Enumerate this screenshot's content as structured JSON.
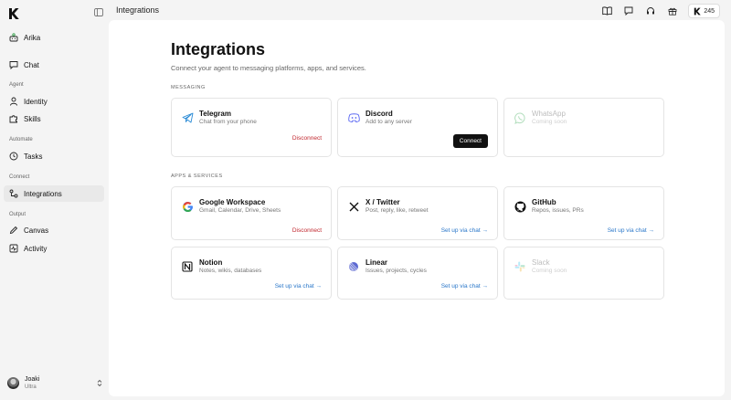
{
  "topbar": {
    "page_title": "Integrations",
    "credits": "245",
    "icons": [
      "book-icon",
      "chat-bubble-icon",
      "headset-icon",
      "gift-icon"
    ]
  },
  "sidebar": {
    "top_items": [
      {
        "label": "Arika",
        "icon": "agent-icon"
      },
      {
        "label": "Chat",
        "icon": "chat-icon"
      }
    ],
    "sections": [
      {
        "label": "Agent",
        "items": [
          {
            "label": "Identity",
            "icon": "person-icon"
          },
          {
            "label": "Skills",
            "icon": "puzzle-icon"
          }
        ]
      },
      {
        "label": "Automate",
        "items": [
          {
            "label": "Tasks",
            "icon": "clock-icon"
          }
        ]
      },
      {
        "label": "Connect",
        "items": [
          {
            "label": "Integrations",
            "icon": "integrations-icon",
            "active": true
          }
        ]
      },
      {
        "label": "Output",
        "items": [
          {
            "label": "Canvas",
            "icon": "pen-icon"
          },
          {
            "label": "Activity",
            "icon": "activity-icon"
          }
        ]
      }
    ],
    "user": {
      "name": "Joaki",
      "plan": "Ultra"
    }
  },
  "main": {
    "title": "Integrations",
    "subtitle": "Connect your agent to messaging platforms, apps, and services.",
    "messaging": {
      "label": "MESSAGING",
      "cards": [
        {
          "name": "Telegram",
          "desc": "Chat from your phone",
          "action": "Disconnect",
          "icon": "telegram-icon"
        },
        {
          "name": "Discord",
          "desc": "Add to any server",
          "action": "Connect",
          "icon": "discord-icon"
        },
        {
          "name": "WhatsApp",
          "desc": "Coming soon",
          "icon": "whatsapp-icon"
        }
      ]
    },
    "apps": {
      "label": "APPS & SERVICES",
      "cards": [
        {
          "name": "Google Workspace",
          "desc": "Gmail, Calendar, Drive, Sheets",
          "action": "Disconnect",
          "icon": "google-icon"
        },
        {
          "name": "X / Twitter",
          "desc": "Post, reply, like, retweet",
          "action": "Set up via chat →",
          "icon": "x-icon"
        },
        {
          "name": "GitHub",
          "desc": "Repos, issues, PRs",
          "action": "Set up via chat →",
          "icon": "github-icon"
        },
        {
          "name": "Notion",
          "desc": "Notes, wikis, databases",
          "action": "Set up via chat →",
          "icon": "notion-icon"
        },
        {
          "name": "Linear",
          "desc": "Issues, projects, cycles",
          "action": "Set up via chat →",
          "icon": "linear-icon"
        },
        {
          "name": "Slack",
          "desc": "Coming soon",
          "icon": "slack-icon"
        }
      ]
    }
  },
  "colors": {
    "danger": "#c0262d",
    "link": "#2a77c9",
    "primary_button": "#111111",
    "panel": "#ffffff",
    "background": "#f4f4f4"
  }
}
